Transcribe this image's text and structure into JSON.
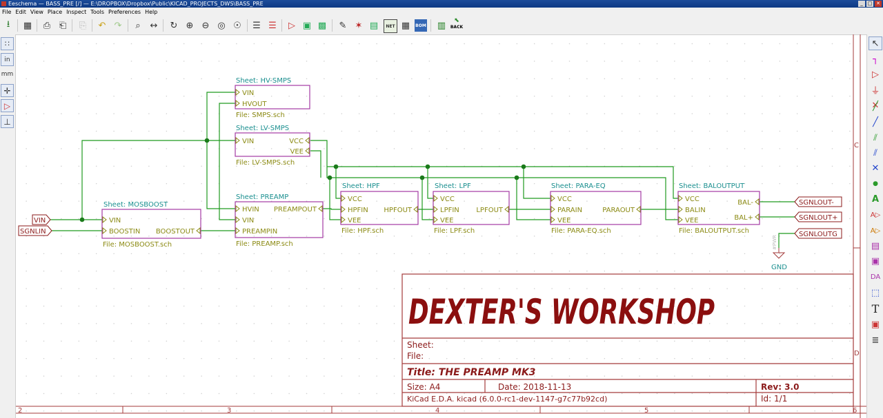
{
  "window": {
    "title": "Eeschema — BASS_PRE [/] — E:\\DROPBOX\\Dropbox\\Public\\KICAD_PROJECTS_DWS\\BASS_PRE",
    "buttons": [
      "_",
      "□",
      "✕"
    ]
  },
  "menu": [
    "File",
    "Edit",
    "View",
    "Place",
    "Inspect",
    "Tools",
    "Preferences",
    "Help"
  ],
  "toolbar": {
    "back_label": "BACK",
    "net_label": "NET",
    "bom_label": "BOM"
  },
  "left_toolbar": {
    "inch_label": "in",
    "mm_label": "mm"
  },
  "colors": {
    "wire": "#1f9a1f",
    "sheet_border": "#a33aa3",
    "sheet_name": "#1a8f8f",
    "pin_text": "#8b8a13",
    "label": "#8b1a1a",
    "frame": "#a33a3a",
    "logo": "#8b0f0f"
  },
  "border": {
    "col_numbers": [
      "2",
      "3",
      "4",
      "5",
      "6"
    ],
    "row_letters": [
      "C",
      "D"
    ]
  },
  "sheets": {
    "hv_smps": {
      "title": "Sheet: HV-SMPS",
      "file": "File: SMPS.sch",
      "pins": [
        "VIN",
        "HVOUT"
      ]
    },
    "lv_smps": {
      "title": "Sheet: LV-SMPS",
      "file": "File: LV-SMPS.sch",
      "left_pins": [
        "VIN"
      ],
      "right_pins": [
        "VCC",
        "VEE"
      ]
    },
    "preamp": {
      "title": "Sheet: PREAMP",
      "file": "File: PREAMP.sch",
      "left_pins": [
        "HVIN",
        "VIN",
        "PREAMPIN"
      ],
      "right_pins": [
        "PREAMPOUT"
      ]
    },
    "mosboost": {
      "title": "Sheet: MOSBOOST",
      "file": "File: MOSBOOST.sch",
      "left_pins": [
        "VIN",
        "BOOSTIN"
      ],
      "right_pins": [
        "BOOSTOUT"
      ]
    },
    "hpf": {
      "title": "Sheet: HPF",
      "file": "File: HPF.sch",
      "left_pins": [
        "VCC",
        "HPFIN",
        "VEE"
      ],
      "right_pins": [
        "HPFOUT"
      ]
    },
    "lpf": {
      "title": "Sheet: LPF",
      "file": "File: LPF.sch",
      "left_pins": [
        "VCC",
        "LPFIN",
        "VEE"
      ],
      "right_pins": [
        "LPFOUT"
      ]
    },
    "para_eq": {
      "title": "Sheet: PARA-EQ",
      "file": "File: PARA-EQ.sch",
      "left_pins": [
        "VCC",
        "PARAIN",
        "VEE"
      ],
      "right_pins": [
        "PARAOUT"
      ]
    },
    "baloutput": {
      "title": "Sheet: BALOUTPUT",
      "file": "File: BALOUTPUT.sch",
      "left_pins": [
        "VCC",
        "BALIN",
        "VEE"
      ],
      "right_pins": [
        "BAL-",
        "BAL+"
      ]
    }
  },
  "labels": {
    "vin": "VIN",
    "sgnlin": "SGNLIN",
    "sgnlout_minus": "SGNLOUT-",
    "sgnlout_plus": "SGNLOUT+",
    "sgnloutg": "SGNLOUTG",
    "gnd": "GND",
    "gnd_ref": "#PWR"
  },
  "title_block": {
    "logo": "DEXTER'S WORKSHOP",
    "sheet_label": "Sheet:",
    "file_label": "File:",
    "title": "Title:  THE  PREAMP  MK3",
    "size": "Size: A4",
    "date": "Date: 2018-11-13",
    "rev": "Rev: 3.0",
    "kicad": "KiCad E.D.A.  kicad (6.0.0-rc1-dev-1147-g7c77b92cd)",
    "id": "Id: 1/1"
  }
}
